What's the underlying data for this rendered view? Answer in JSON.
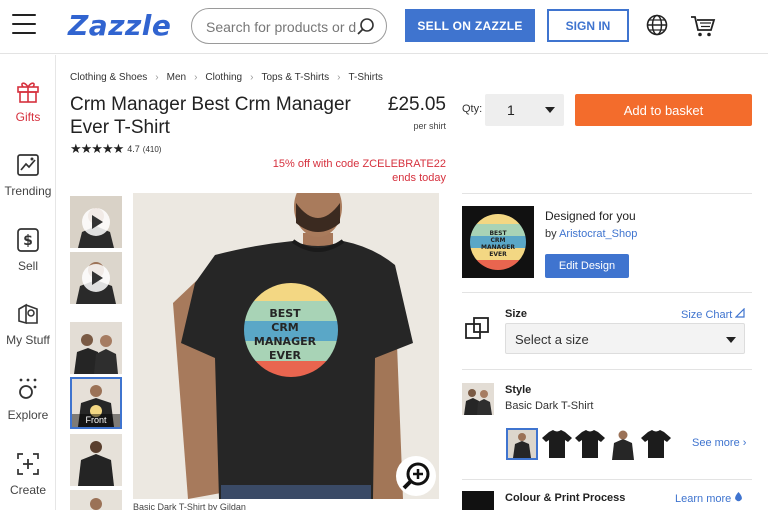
{
  "header": {
    "logo": "Zazzle",
    "search_placeholder": "Search for products or designs",
    "sell_label": "SELL ON ZAZZLE",
    "signin_label": "SIGN IN"
  },
  "leftnav": {
    "items": [
      {
        "label": "Gifts",
        "icon": "gift-icon",
        "active": true
      },
      {
        "label": "Trending",
        "icon": "trending-icon"
      },
      {
        "label": "Sell",
        "icon": "dollar-icon"
      },
      {
        "label": "My Stuff",
        "icon": "my-stuff-icon"
      },
      {
        "label": "Explore",
        "icon": "explore-icon"
      },
      {
        "label": "Create",
        "icon": "create-icon"
      }
    ]
  },
  "breadcrumb": [
    "Clothing & Shoes",
    "Men",
    "Clothing",
    "Tops & T-Shirts",
    "T-Shirts"
  ],
  "product": {
    "title": "Crm Manager Best Crm Manager Ever T-Shirt",
    "rating_value": "4.7",
    "rating_count": "(410)",
    "price": "£25.05",
    "price_unit": "per shirt",
    "promo_line1": "15% off with code ZCELEBRATE22",
    "promo_line2": "ends today",
    "shirt_text": [
      "BEST",
      "CRM",
      "MANAGER",
      "EVER"
    ],
    "thumb_selected_label": "Front",
    "caption": "Basic Dark T-Shirt by Gildan"
  },
  "purchase": {
    "qty_label": "Qty:",
    "qty_value": "1",
    "basket_label": "Add to basket"
  },
  "design": {
    "title": "Designed for you",
    "by_prefix": "by ",
    "designer": "Aristocrat_Shop",
    "edit_label": "Edit Design"
  },
  "size": {
    "label": "Size",
    "chart_label": "Size Chart",
    "placeholder": "Select a size"
  },
  "style": {
    "label": "Style",
    "value": "Basic Dark T-Shirt",
    "see_more": "See more ›"
  },
  "colour": {
    "label": "Colour & Print Process",
    "learn_more": "Learn more"
  },
  "colors": {
    "brand_blue": "#3f74cf",
    "basket_orange": "#f36c2c",
    "promo_red": "#d6313e",
    "shirt": "#262626",
    "stripes": [
      "#d9465e",
      "#ee8a4e",
      "#f3d783",
      "#a8d3b6",
      "#5aa7c7"
    ]
  }
}
